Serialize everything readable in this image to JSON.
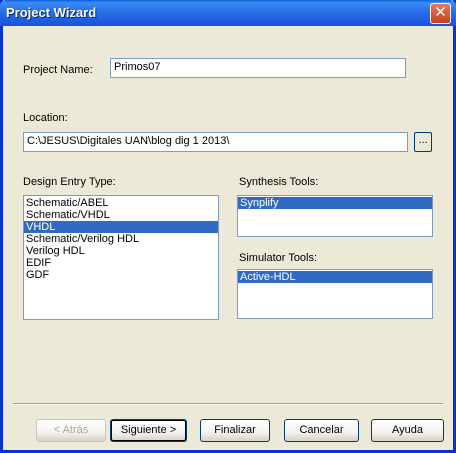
{
  "window": {
    "title": "Project Wizard"
  },
  "project_name": {
    "label": "Project Name:",
    "value": "Primos07"
  },
  "location": {
    "label": "Location:",
    "value": "C:\\JESUS\\Digitales UAN\\blog dig 1 2013\\",
    "browse_label": "..."
  },
  "design_entry": {
    "label": "Design Entry Type:",
    "items": [
      "Schematic/ABEL",
      "Schematic/VHDL",
      "VHDL",
      "Schematic/Verilog HDL",
      "Verilog HDL",
      "EDIF",
      "GDF"
    ],
    "selected": "VHDL"
  },
  "synthesis": {
    "label": "Synthesis Tools:",
    "items": [
      "Synplify"
    ],
    "selected": "Synplify"
  },
  "simulator": {
    "label": "Simulator Tools:",
    "items": [
      "Active-HDL"
    ],
    "selected": "Active-HDL"
  },
  "buttons": {
    "back": "< Atrás",
    "next": "Siguiente >",
    "finish": "Finalizar",
    "cancel": "Cancelar",
    "help": "Ayuda"
  },
  "colors": {
    "selection": "#316ac5",
    "titlebar": "#1554d8",
    "face": "#ece9d8"
  }
}
